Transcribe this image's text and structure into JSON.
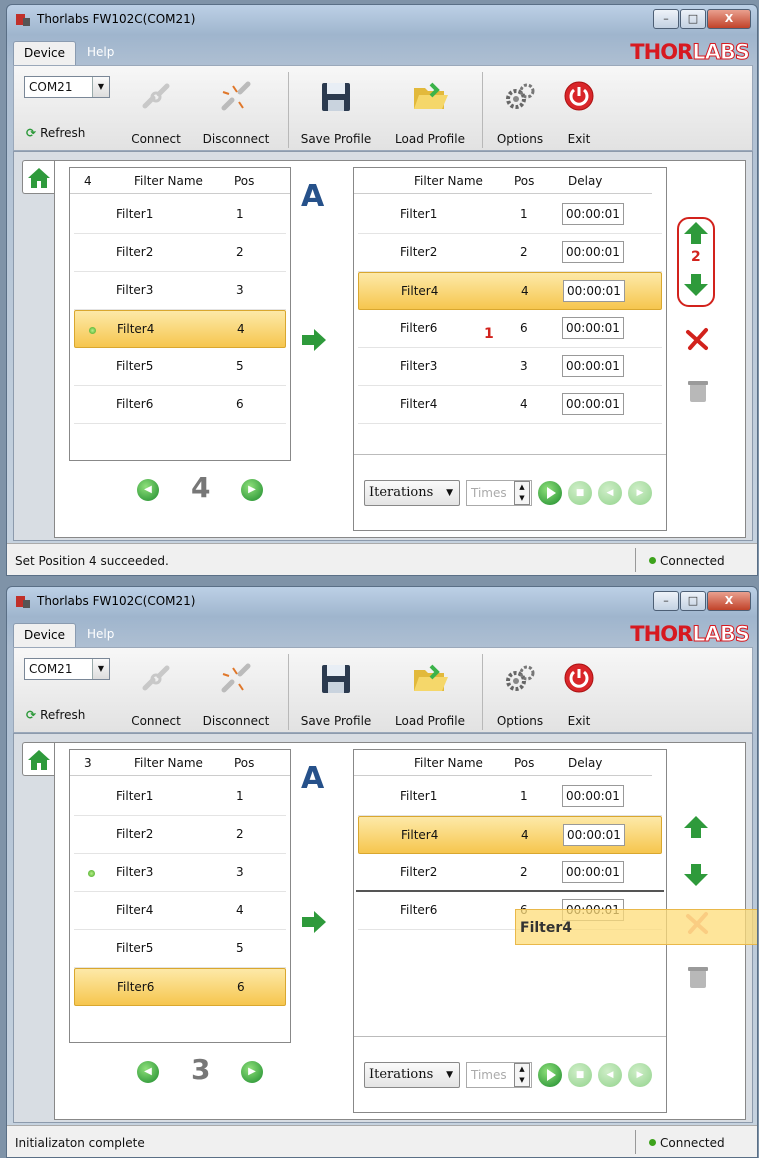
{
  "windows": [
    {
      "title": "Thorlabs FW102C(COM21)",
      "tabs": {
        "device": "Device",
        "help": "Help"
      },
      "brand": {
        "part1": "THOR",
        "part2": "LABS"
      },
      "ribbon": {
        "port": "COM21",
        "refresh": "Refresh",
        "connect": "Connect",
        "disconnect": "Disconnect",
        "save_profile": "Save Profile",
        "load_profile": "Load Profile",
        "options": "Options",
        "exit": "Exit"
      },
      "left_list": {
        "count": "4",
        "col_name": "Filter Name",
        "col_pos": "Pos",
        "rows": [
          {
            "name": "Filter1",
            "pos": "1"
          },
          {
            "name": "Filter2",
            "pos": "2"
          },
          {
            "name": "Filter3",
            "pos": "3"
          },
          {
            "name": "Filter4",
            "pos": "4"
          },
          {
            "name": "Filter5",
            "pos": "5"
          },
          {
            "name": "Filter6",
            "pos": "6"
          }
        ],
        "current": "4"
      },
      "big_label": "A",
      "right_list": {
        "col_name": "Filter Name",
        "col_pos": "Pos",
        "col_delay": "Delay",
        "rows": [
          {
            "name": "Filter1",
            "pos": "1",
            "delay": "00:00:01"
          },
          {
            "name": "Filter2",
            "pos": "2",
            "delay": "00:00:01"
          },
          {
            "name": "Filter4",
            "pos": "4",
            "delay": "00:00:01"
          },
          {
            "name": "Filter6",
            "pos": "6",
            "delay": "00:00:01"
          },
          {
            "name": "Filter3",
            "pos": "3",
            "delay": "00:00:01"
          },
          {
            "name": "Filter4",
            "pos": "4",
            "delay": "00:00:01"
          }
        ]
      },
      "iterations": "Iterations",
      "times_placeholder": "Times",
      "annotations": {
        "one": "1",
        "two": "2"
      },
      "status": "Set Position 4 succeeded.",
      "connection": "Connected"
    },
    {
      "title": "Thorlabs FW102C(COM21)",
      "tabs": {
        "device": "Device",
        "help": "Help"
      },
      "brand": {
        "part1": "THOR",
        "part2": "LABS"
      },
      "ribbon": {
        "port": "COM21",
        "refresh": "Refresh",
        "connect": "Connect",
        "disconnect": "Disconnect",
        "save_profile": "Save Profile",
        "load_profile": "Load Profile",
        "options": "Options",
        "exit": "Exit"
      },
      "left_list": {
        "count": "3",
        "col_name": "Filter Name",
        "col_pos": "Pos",
        "rows": [
          {
            "name": "Filter1",
            "pos": "1"
          },
          {
            "name": "Filter2",
            "pos": "2"
          },
          {
            "name": "Filter3",
            "pos": "3"
          },
          {
            "name": "Filter4",
            "pos": "4"
          },
          {
            "name": "Filter5",
            "pos": "5"
          },
          {
            "name": "Filter6",
            "pos": "6"
          }
        ],
        "current": "3"
      },
      "big_label": "A",
      "right_list": {
        "col_name": "Filter Name",
        "col_pos": "Pos",
        "col_delay": "Delay",
        "rows": [
          {
            "name": "Filter1",
            "pos": "1",
            "delay": "00:00:01"
          },
          {
            "name": "Filter4",
            "pos": "4",
            "delay": "00:00:01"
          },
          {
            "name": "Filter2",
            "pos": "2",
            "delay": "00:00:01"
          },
          {
            "name": "Filter6",
            "pos": "6",
            "delay": "00:00:01"
          }
        ],
        "drag_ghost": "Filter4"
      },
      "iterations": "Iterations",
      "times_placeholder": "Times",
      "status": "Initializaton complete",
      "connection": "Connected"
    }
  ]
}
